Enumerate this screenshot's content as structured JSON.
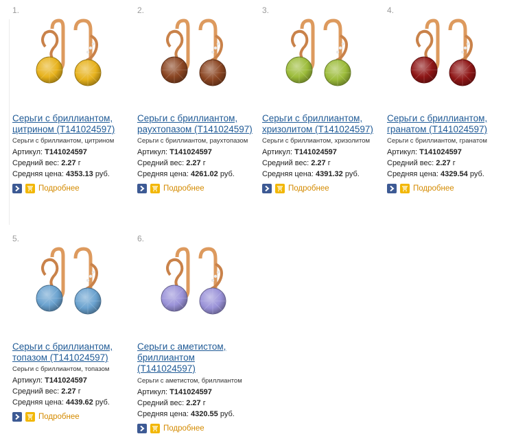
{
  "labels": {
    "article": "Артикул:",
    "weight": "Средний вес:",
    "price": "Средняя цена:",
    "more": "Подробнее"
  },
  "products": [
    {
      "num": "1.",
      "title_line1": "Серьги с бриллиантом,",
      "title_line2": "цитрином (Т141024597)",
      "title_line3": "",
      "desc": "Серьги с бриллиантом, цитрином",
      "article": "Т141024597",
      "weight": "2.27",
      "weight_unit": "г",
      "price": "4353.13",
      "currency": "руб.",
      "stone_color": "#e7b21c"
    },
    {
      "num": "2.",
      "title_line1": "Серьги с бриллиантом,",
      "title_line2": "раухтопазом (Т141024597)",
      "title_line3": "",
      "desc": "Серьги с бриллиантом, раухтопазом",
      "article": "Т141024597",
      "weight": "2.27",
      "weight_unit": "г",
      "price": "4261.02",
      "currency": "руб.",
      "stone_color": "#8a4522"
    },
    {
      "num": "3.",
      "title_line1": "Серьги с бриллиантом,",
      "title_line2": "хризолитом (Т141024597)",
      "title_line3": "",
      "desc": "Серьги с бриллиантом, хризолитом",
      "article": "Т141024597",
      "weight": "2.27",
      "weight_unit": "г",
      "price": "4391.32",
      "currency": "руб.",
      "stone_color": "#9cbc3a"
    },
    {
      "num": "4.",
      "title_line1": "Серьги с бриллиантом,",
      "title_line2": "гранатом (Т141024597)",
      "title_line3": "",
      "desc": "Серьги с бриллиантом, гранатом",
      "article": "Т141024597",
      "weight": "2.27",
      "weight_unit": "г",
      "price": "4329.54",
      "currency": "руб.",
      "stone_color": "#8e1616"
    },
    {
      "num": "5.",
      "title_line1": "Серьги с бриллиантом,",
      "title_line2": "топазом (Т141024597)",
      "title_line3": "",
      "desc": "Серьги с бриллиантом, топазом",
      "article": "Т141024597",
      "weight": "2.27",
      "weight_unit": "г",
      "price": "4439.62",
      "currency": "руб.",
      "stone_color": "#6aa2cf"
    },
    {
      "num": "6.",
      "title_line1": "Серьги с аметистом,",
      "title_line2": "бриллиантом",
      "title_line3": "(Т141024597)",
      "desc": "Серьги с аметистом, бриллиантом",
      "article": "Т141024597",
      "weight": "2.27",
      "weight_unit": "г",
      "price": "4320.55",
      "currency": "руб.",
      "stone_color": "#9a92d8"
    }
  ],
  "colors": {
    "link": "#1f5a96",
    "more": "#d48a00",
    "gold": "#dd9a5e"
  }
}
